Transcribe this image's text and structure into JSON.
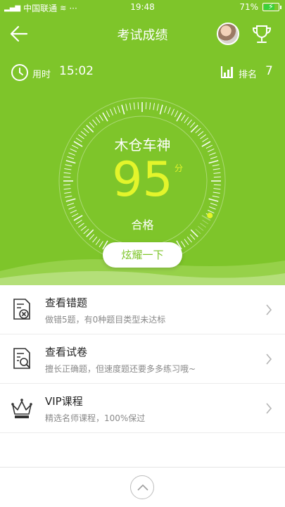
{
  "status_bar": {
    "carrier": "中国联通",
    "dots": "···",
    "time": "19:48",
    "battery": "71%"
  },
  "header": {
    "title": "考试成绩"
  },
  "meta": {
    "time_label": "用时",
    "time_value": "15:02",
    "rank_label": "排名",
    "rank_value": "7"
  },
  "result": {
    "username": "木仓车神",
    "score": "95",
    "unit": "分",
    "grade": "合格",
    "share_label": "炫耀一下"
  },
  "items": [
    {
      "title": "查看错题",
      "subtitle": "做错5题，有0种题目类型未达标",
      "icon": "wrong-questions-icon"
    },
    {
      "title": "查看试卷",
      "subtitle": "擅长正确题，但速度题还要多多练习哦~",
      "icon": "view-paper-icon"
    },
    {
      "title": "VIP课程",
      "subtitle": "精选名师课程，100%保过",
      "icon": "crown-icon"
    }
  ],
  "colors": {
    "brand_green": "#7ec52a",
    "score_yellow": "#e3f52b"
  }
}
